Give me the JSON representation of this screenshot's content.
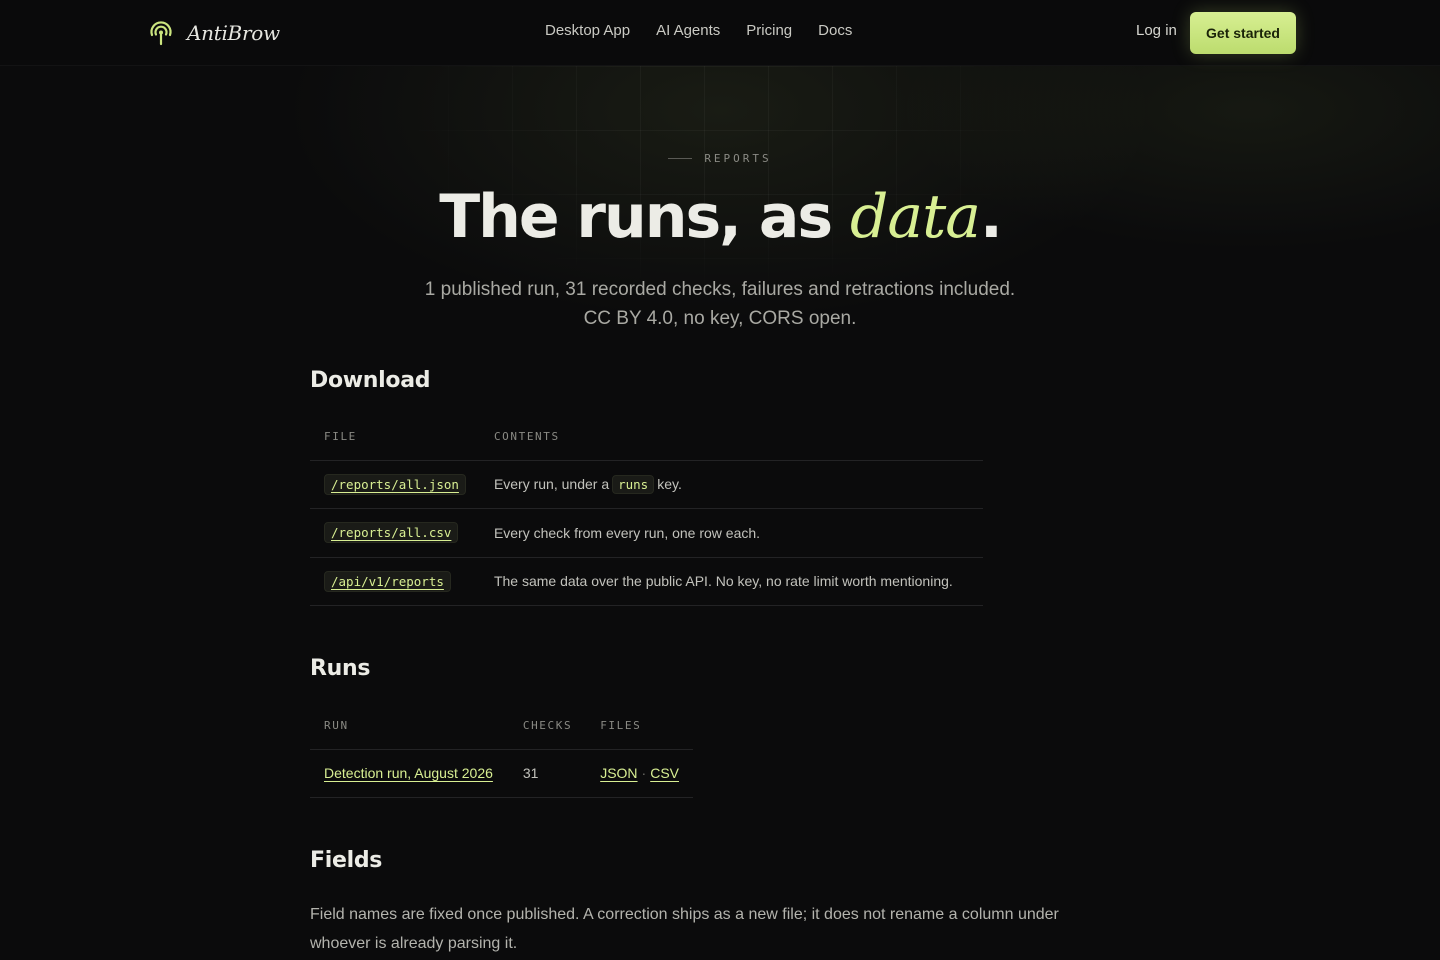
{
  "header": {
    "brand": "AntiBrow",
    "brand_icon": "broadcast-icon",
    "nav": [
      "Desktop App",
      "AI Agents",
      "Pricing",
      "Docs"
    ],
    "login": "Log in",
    "cta": "Get started"
  },
  "hero": {
    "eyebrow": "REPORTS",
    "title_main": "The runs, as ",
    "title_accent": "data",
    "title_end": ".",
    "subtitle": "1 published run, 31 recorded checks, failures and retractions included. CC BY 4.0, no key, CORS open."
  },
  "download": {
    "title": "Download",
    "headers": [
      "FILE",
      "CONTENTS"
    ],
    "rows": [
      {
        "file": "/reports/all.json",
        "contents_pre": "Every run, under a",
        "contents_code": "runs",
        "contents_post": "key."
      },
      {
        "file": "/reports/all.csv",
        "contents": "Every check from every run, one row each."
      },
      {
        "file": "/api/v1/reports",
        "contents": "The same data over the public API. No key, no rate limit worth mentioning."
      }
    ]
  },
  "runs": {
    "title": "Runs",
    "headers": [
      "RUN",
      "CHECKS",
      "FILES"
    ],
    "rows": [
      {
        "run": "Detection run, August 2026",
        "checks": "31",
        "json": "JSON",
        "sep": "·",
        "csv": "CSV"
      }
    ]
  },
  "fields": {
    "title": "Fields",
    "text": "Field names are fixed once published. A correction ships as a new file; it does not rename a column under whoever is already parsing it."
  },
  "colors": {
    "background": "#0b0b0c",
    "accent": "#d8ef93",
    "cta": "#c5e37a"
  }
}
